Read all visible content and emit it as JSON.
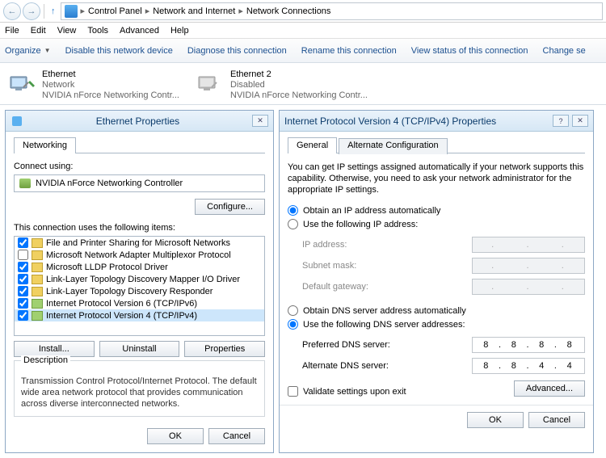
{
  "nav": {
    "crumbs": [
      "Control Panel",
      "Network and Internet",
      "Network Connections"
    ]
  },
  "menu": [
    "File",
    "Edit",
    "View",
    "Tools",
    "Advanced",
    "Help"
  ],
  "toolbar": {
    "organize": "Organize",
    "disable": "Disable this network device",
    "diagnose": "Diagnose this connection",
    "rename": "Rename this connection",
    "status": "View status of this connection",
    "change": "Change se"
  },
  "connections": [
    {
      "name": "Ethernet",
      "status": "Network",
      "device": "NVIDIA nForce Networking Contr...",
      "state": "enabled"
    },
    {
      "name": "Ethernet 2",
      "status": "Disabled",
      "device": "NVIDIA nForce Networking Contr...",
      "state": "disabled"
    }
  ],
  "ethDialog": {
    "title": "Ethernet Properties",
    "tabNetworking": "Networking",
    "connectUsing": "Connect using:",
    "adapter": "NVIDIA nForce Networking Controller",
    "configure": "Configure...",
    "itemsLabel": "This connection uses the following items:",
    "items": [
      {
        "checked": true,
        "label": "File and Printer Sharing for Microsoft Networks",
        "type": "svc"
      },
      {
        "checked": false,
        "label": "Microsoft Network Adapter Multiplexor Protocol",
        "type": "svc"
      },
      {
        "checked": true,
        "label": "Microsoft LLDP Protocol Driver",
        "type": "svc"
      },
      {
        "checked": true,
        "label": "Link-Layer Topology Discovery Mapper I/O Driver",
        "type": "svc"
      },
      {
        "checked": true,
        "label": "Link-Layer Topology Discovery Responder",
        "type": "svc"
      },
      {
        "checked": true,
        "label": "Internet Protocol Version 6 (TCP/IPv6)",
        "type": "proto"
      },
      {
        "checked": true,
        "label": "Internet Protocol Version 4 (TCP/IPv4)",
        "type": "proto",
        "selected": true
      }
    ],
    "install": "Install...",
    "uninstall": "Uninstall",
    "properties": "Properties",
    "descLabel": "Description",
    "desc": "Transmission Control Protocol/Internet Protocol. The default wide area network protocol that provides communication across diverse interconnected networks.",
    "ok": "OK",
    "cancel": "Cancel"
  },
  "ipv4Dialog": {
    "title": "Internet Protocol Version 4 (TCP/IPv4) Properties",
    "tabGeneral": "General",
    "tabAlt": "Alternate Configuration",
    "info": "You can get IP settings assigned automatically if your network supports this capability. Otherwise, you need to ask your network administrator for the appropriate IP settings.",
    "rAuto": "Obtain an IP address automatically",
    "rManual": "Use the following IP address:",
    "ipLabel": "IP address:",
    "subnetLabel": "Subnet mask:",
    "gwLabel": "Default gateway:",
    "rDnsAuto": "Obtain DNS server address automatically",
    "rDnsManual": "Use the following DNS server addresses:",
    "prefDns": "Preferred DNS server:",
    "altDns": "Alternate DNS server:",
    "dns1": [
      "8",
      "8",
      "8",
      "8"
    ],
    "dns2": [
      "8",
      "8",
      "4",
      "4"
    ],
    "validate": "Validate settings upon exit",
    "advanced": "Advanced...",
    "ok": "OK",
    "cancel": "Cancel"
  }
}
